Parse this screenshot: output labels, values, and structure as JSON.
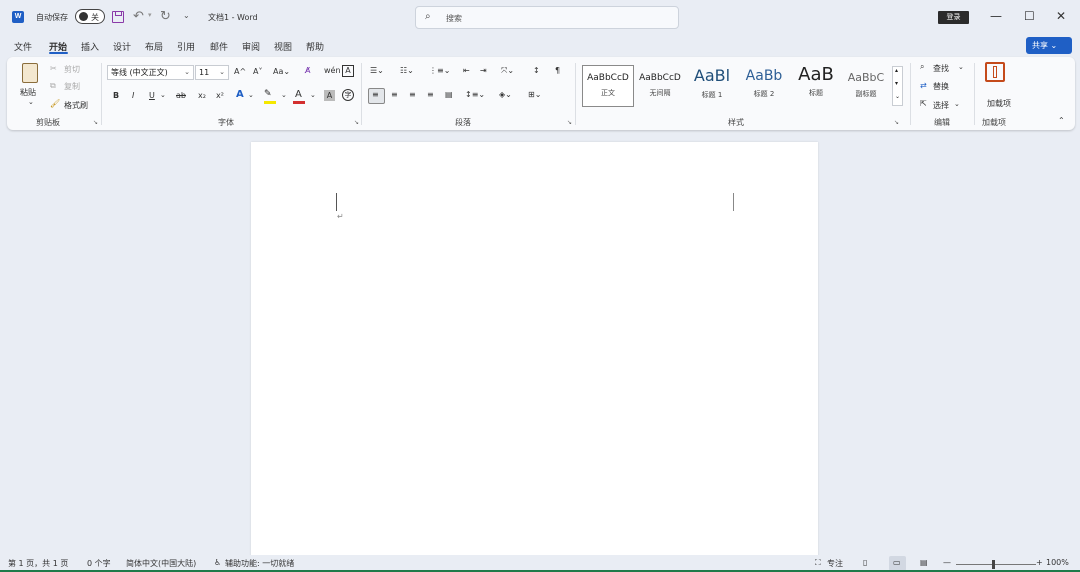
{
  "titlebar": {
    "app_icon": "word-logo-icon",
    "autosave_label": "自动保存",
    "autosave_state": "关",
    "doc_title": "文档1 - Word",
    "search_placeholder": "搜索",
    "login_label": "登录"
  },
  "tabs": [
    "文件",
    "开始",
    "插入",
    "设计",
    "布局",
    "引用",
    "邮件",
    "审阅",
    "视图",
    "帮助"
  ],
  "active_tab": "开始",
  "share_label": "共享",
  "ribbon": {
    "clipboard": {
      "paste": "粘贴",
      "cut": "剪切",
      "copy": "复制",
      "format_painter": "格式刷",
      "group": "剪贴板"
    },
    "font": {
      "family": "等线 (中文正文)",
      "size": "11",
      "group": "字体"
    },
    "paragraph": {
      "group": "段落"
    },
    "styles": {
      "items": [
        {
          "sample": "AaBbCcD",
          "name": "正文"
        },
        {
          "sample": "AaBbCcD",
          "name": "无间隔"
        },
        {
          "sample": "AaBl",
          "name": "标题 1"
        },
        {
          "sample": "AaBb",
          "name": "标题 2"
        },
        {
          "sample": "AaB",
          "name": "标题"
        },
        {
          "sample": "AaBbC",
          "name": "副标题"
        }
      ],
      "group": "样式"
    },
    "editing": {
      "find": "查找",
      "replace": "替换",
      "select": "选择",
      "group": "编辑"
    },
    "addins": {
      "button": "加载项",
      "group": "加载项"
    }
  },
  "document": {
    "paragraph_mark": "↵"
  },
  "statusbar": {
    "page": "第 1 页，共 1 页",
    "words": "0 个字",
    "language": "简体中文(中国大陆)",
    "accessibility": "辅助功能: 一切就绪",
    "focus": "专注",
    "zoom": "100%"
  },
  "colors": {
    "accent": "#1f5fc5",
    "highlight": "#f5e800",
    "font_color": "#d32f2f",
    "status_green": "#1e7a4a"
  }
}
